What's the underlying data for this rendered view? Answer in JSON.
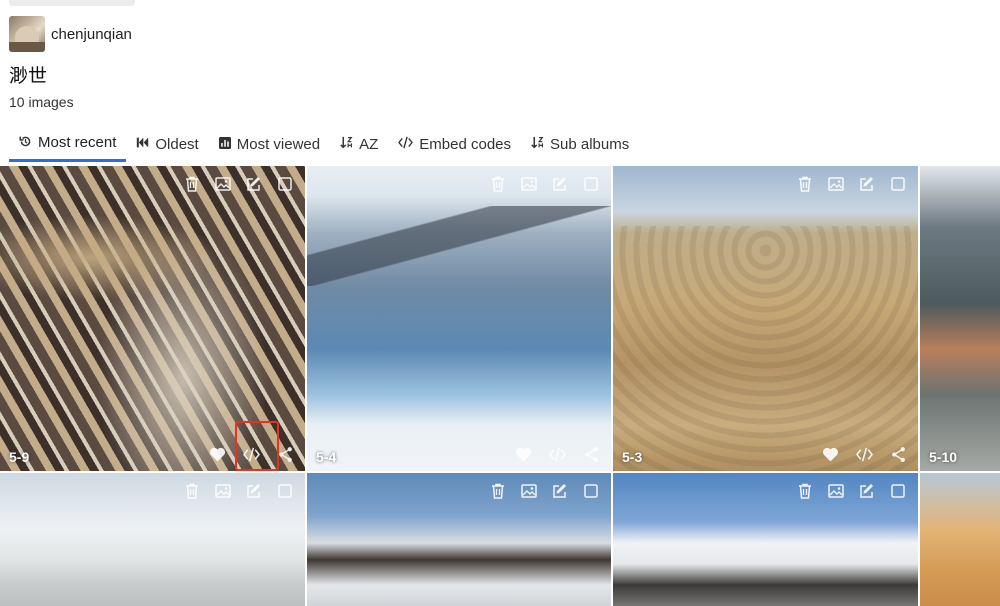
{
  "owner": {
    "name": "chenjunqian"
  },
  "album": {
    "title": "渺世",
    "count": "10 images"
  },
  "tabs": [
    {
      "label": "Most recent",
      "icon": "history-icon",
      "active": true
    },
    {
      "label": "Oldest",
      "icon": "skip-back-icon"
    },
    {
      "label": "Most viewed",
      "icon": "chart-icon"
    },
    {
      "label": "AZ",
      "icon": "sort-icon"
    },
    {
      "label": "Embed codes",
      "icon": "code-icon"
    },
    {
      "label": "Sub albums",
      "icon": "sort-icon"
    }
  ],
  "tiles": [
    {
      "label": "5-9"
    },
    {
      "label": "5-4"
    },
    {
      "label": "5-3"
    },
    {
      "label": "5-10"
    },
    {
      "label": ""
    },
    {
      "label": ""
    },
    {
      "label": ""
    },
    {
      "label": ""
    }
  ],
  "colors": {
    "accent": "#2a6fdb",
    "highlight": "#e8321f"
  }
}
